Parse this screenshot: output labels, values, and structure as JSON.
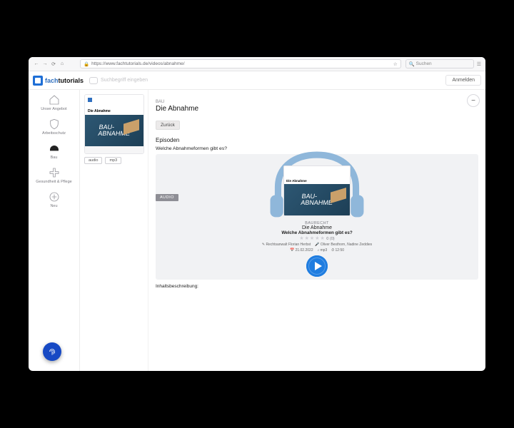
{
  "browser": {
    "url": "https://www.fachtutorials.de/videos/abnahme/",
    "search_placeholder": "Suchen"
  },
  "header": {
    "brand_part1": "fach",
    "brand_part2": "tutorials",
    "search_placeholder": "Suchbegriff eingeben",
    "login_label": "Anmelden"
  },
  "sidebar": {
    "items": [
      {
        "label": "Unser Angebot",
        "icon": "home"
      },
      {
        "label": "Arbeitsschutz",
        "icon": "shield"
      },
      {
        "label": "Bau",
        "icon": "hardhat"
      },
      {
        "label": "Gesundheit & Pflege",
        "icon": "medical"
      },
      {
        "label": "Neu",
        "icon": "plus"
      }
    ]
  },
  "thumbnail": {
    "label": "Die Abnahme",
    "art_line1": "BAU-",
    "art_line2": "ABNAHME",
    "buttons": [
      "audio",
      "mp3"
    ]
  },
  "detail": {
    "eyebrow": "BAU",
    "title": "Die Abnahme",
    "back_label": "Zurück",
    "episodes_heading": "Episoden",
    "question": "Welche Abnahmeformen gibt es?",
    "audio_badge": "AUDIO",
    "card": {
      "category": "BAURECHT",
      "title": "Die Abnahme",
      "question": "Welche Abnahmeformen gibt es?",
      "rating_count": "0 (0)",
      "author": "Rechtsanwalt Florian Herbst",
      "speakers": "Oliver Besthorn, Nadine Zeddies",
      "date": "21.02.2022",
      "format": "mp3",
      "duration": "12:50"
    },
    "description_heading": "Inhaltsbeschreibung:"
  },
  "colors": {
    "accent": "#1f7de0",
    "fab": "#1749c4"
  }
}
